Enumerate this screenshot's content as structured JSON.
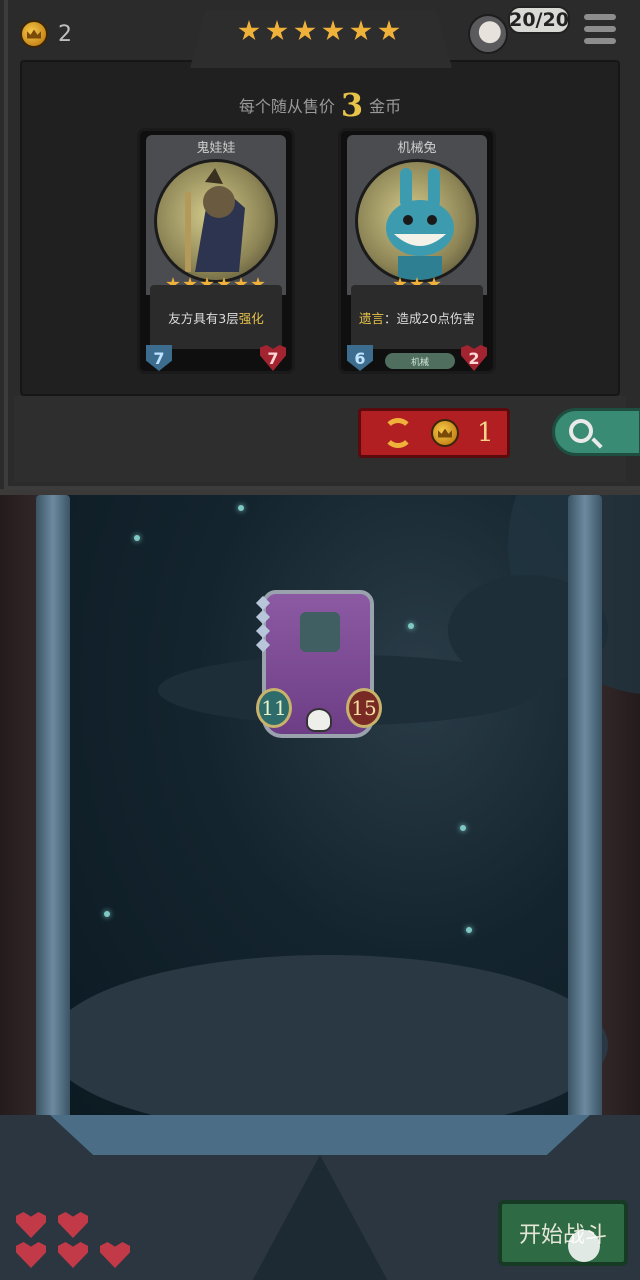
{
  "top_bar": {
    "gold": "2",
    "tier_stars": 6,
    "population": "20/20"
  },
  "shop": {
    "sell_prefix": "每个随从售价",
    "sell_value": "3",
    "sell_suffix": "金币",
    "cards": [
      {
        "name": "鬼娃娃",
        "stars": 6,
        "desc_plain": "友方具有3层",
        "desc_hl": "强化",
        "attack": "7",
        "health": "7",
        "tag": ""
      },
      {
        "name": "机械兔",
        "stars": 3,
        "desc_hl": "遗言",
        "desc_plain": "：造成20点伤害",
        "attack": "6",
        "health": "2",
        "tag": "机械"
      }
    ],
    "refresh_cost": "1"
  },
  "board": {
    "minion": {
      "attack": "11",
      "health": "15",
      "gems": 4
    }
  },
  "player": {
    "lives_total": 5,
    "lives_remaining": 5
  },
  "start_button": "开始战斗",
  "colors": {
    "gold": "#e7c34a",
    "refresh": "#b21f22",
    "start": "#2e6b44",
    "search": "#3a8b73"
  }
}
